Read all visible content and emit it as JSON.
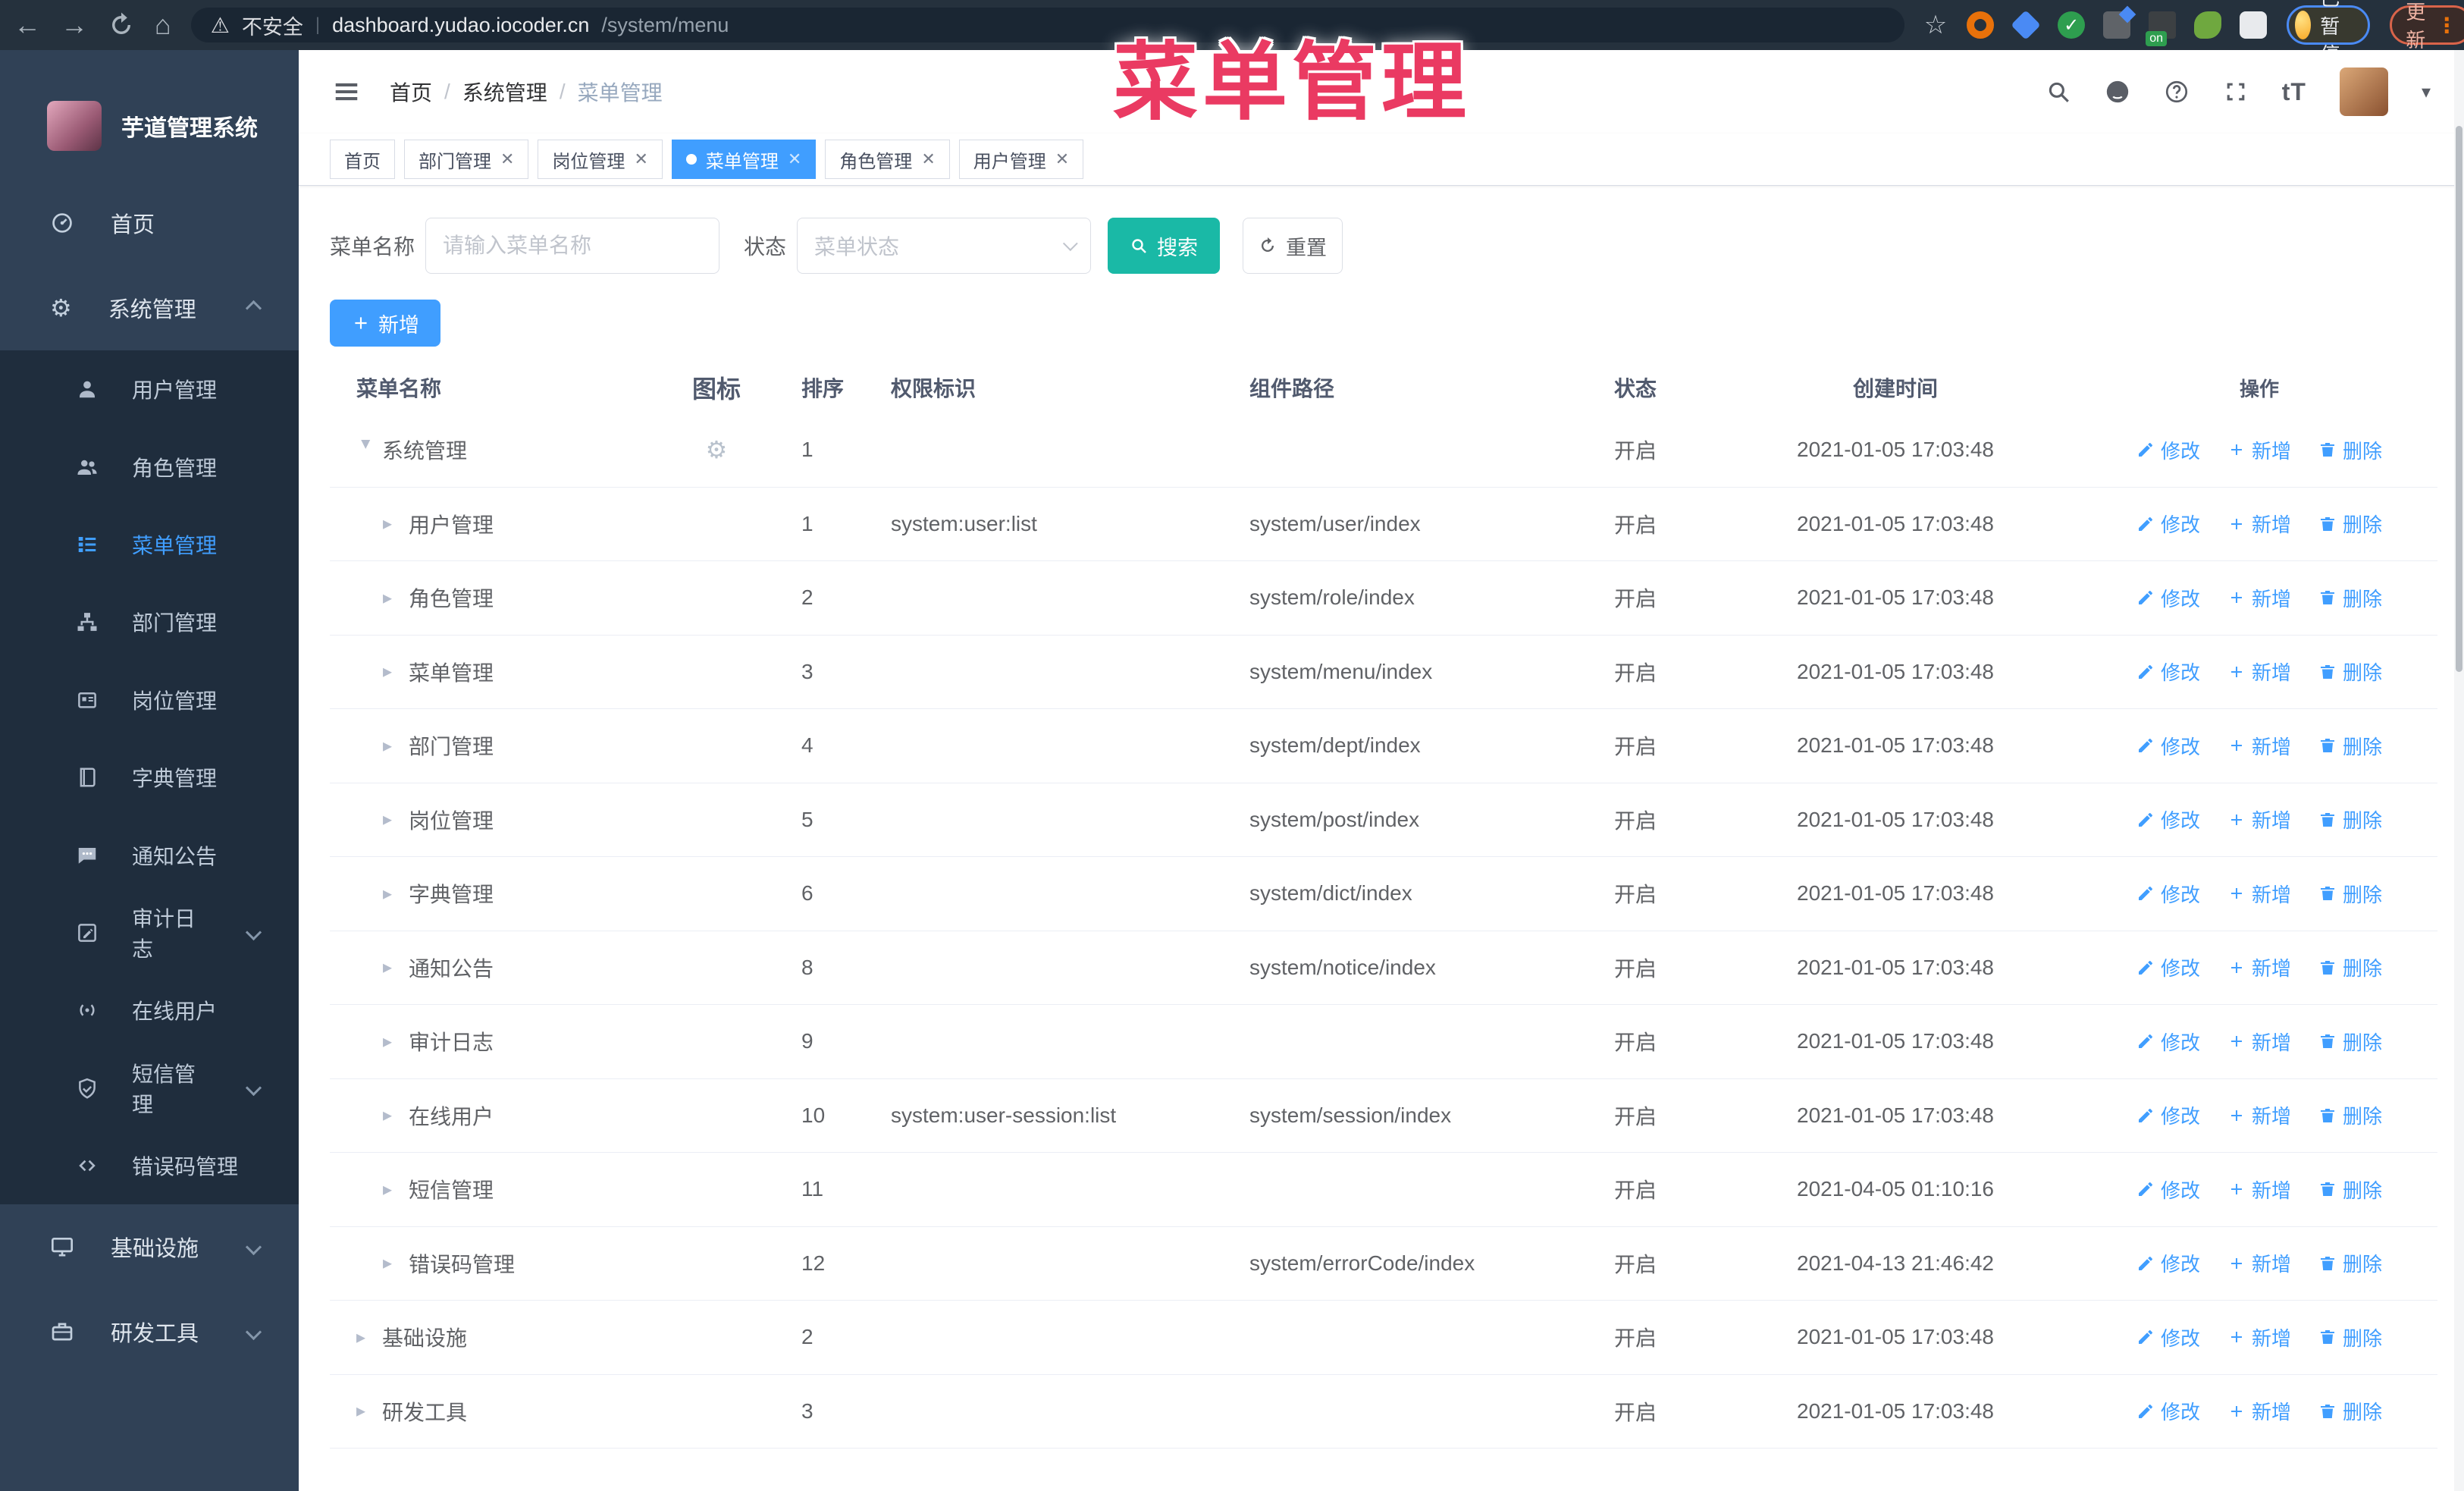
{
  "browser": {
    "security_label": "不安全",
    "url_host": "dashboard.yudao.iocoder.cn",
    "url_path": "/system/menu",
    "paused_badge": "已暂停",
    "update_button": "更新"
  },
  "annotation": {
    "text": "菜单管理",
    "color": "#ea3a62"
  },
  "sidebar": {
    "title": "芋道管理系统",
    "items": [
      {
        "label": "首页",
        "icon": "dashboard",
        "type": "top"
      },
      {
        "label": "系统管理",
        "icon": "cog",
        "type": "top",
        "caret": "up"
      },
      {
        "label": "用户管理",
        "icon": "user",
        "type": "sub"
      },
      {
        "label": "角色管理",
        "icon": "users",
        "type": "sub"
      },
      {
        "label": "菜单管理",
        "icon": "tree-table",
        "type": "sub",
        "active": true
      },
      {
        "label": "部门管理",
        "icon": "tree",
        "type": "sub"
      },
      {
        "label": "岗位管理",
        "icon": "post",
        "type": "sub"
      },
      {
        "label": "字典管理",
        "icon": "dict",
        "type": "sub"
      },
      {
        "label": "通知公告",
        "icon": "message",
        "type": "sub"
      },
      {
        "label": "审计日志",
        "icon": "log",
        "type": "sub",
        "caret": "down"
      },
      {
        "label": "在线用户",
        "icon": "online",
        "type": "sub"
      },
      {
        "label": "短信管理",
        "icon": "sms",
        "type": "sub",
        "caret": "down"
      },
      {
        "label": "错误码管理",
        "icon": "code",
        "type": "sub"
      },
      {
        "label": "基础设施",
        "icon": "monitor",
        "type": "top",
        "caret": "down"
      },
      {
        "label": "研发工具",
        "icon": "tool",
        "type": "top",
        "caret": "down"
      }
    ]
  },
  "header": {
    "breadcrumb": [
      "首页",
      "系统管理",
      "菜单管理"
    ]
  },
  "tags": [
    {
      "label": "首页",
      "closable": false,
      "active": false
    },
    {
      "label": "部门管理",
      "closable": true,
      "active": false
    },
    {
      "label": "岗位管理",
      "closable": true,
      "active": false
    },
    {
      "label": "菜单管理",
      "closable": true,
      "active": true
    },
    {
      "label": "角色管理",
      "closable": true,
      "active": false
    },
    {
      "label": "用户管理",
      "closable": true,
      "active": false
    }
  ],
  "search": {
    "name_label": "菜单名称",
    "name_placeholder": "请输入菜单名称",
    "status_label": "状态",
    "status_placeholder": "菜单状态",
    "search_button": "搜索",
    "reset_button": "重置"
  },
  "toolbar": {
    "add_button": "新增"
  },
  "table": {
    "columns": [
      "菜单名称",
      "图标",
      "排序",
      "权限标识",
      "组件路径",
      "状态",
      "创建时间",
      "操作"
    ],
    "ops": {
      "edit": "修改",
      "add": "新增",
      "delete": "删除"
    },
    "rows": [
      {
        "name": "系统管理",
        "icon": "cog",
        "level": 0,
        "expanded": true,
        "sort": "1",
        "perm": "",
        "path": "",
        "status": "开启",
        "time": "2021-01-05 17:03:48"
      },
      {
        "name": "用户管理",
        "icon": "user",
        "level": 1,
        "expanded": false,
        "sort": "1",
        "perm": "system:user:list",
        "path": "system/user/index",
        "status": "开启",
        "time": "2021-01-05 17:03:48"
      },
      {
        "name": "角色管理",
        "icon": "users",
        "level": 1,
        "expanded": false,
        "sort": "2",
        "perm": "",
        "path": "system/role/index",
        "status": "开启",
        "time": "2021-01-05 17:03:48"
      },
      {
        "name": "菜单管理",
        "icon": "tree-table",
        "level": 1,
        "expanded": false,
        "sort": "3",
        "perm": "",
        "path": "system/menu/index",
        "status": "开启",
        "time": "2021-01-05 17:03:48"
      },
      {
        "name": "部门管理",
        "icon": "tree",
        "level": 1,
        "expanded": false,
        "sort": "4",
        "perm": "",
        "path": "system/dept/index",
        "status": "开启",
        "time": "2021-01-05 17:03:48"
      },
      {
        "name": "岗位管理",
        "icon": "post",
        "level": 1,
        "expanded": false,
        "sort": "5",
        "perm": "",
        "path": "system/post/index",
        "status": "开启",
        "time": "2021-01-05 17:03:48"
      },
      {
        "name": "字典管理",
        "icon": "dict",
        "level": 1,
        "expanded": false,
        "sort": "6",
        "perm": "",
        "path": "system/dict/index",
        "status": "开启",
        "time": "2021-01-05 17:03:48"
      },
      {
        "name": "通知公告",
        "icon": "message",
        "level": 1,
        "expanded": false,
        "sort": "8",
        "perm": "",
        "path": "system/notice/index",
        "status": "开启",
        "time": "2021-01-05 17:03:48"
      },
      {
        "name": "审计日志",
        "icon": "log",
        "level": 1,
        "expanded": false,
        "sort": "9",
        "perm": "",
        "path": "",
        "status": "开启",
        "time": "2021-01-05 17:03:48"
      },
      {
        "name": "在线用户",
        "icon": "online",
        "level": 1,
        "expanded": false,
        "sort": "10",
        "perm": "system:user-session:list",
        "path": "system/session/index",
        "status": "开启",
        "time": "2021-01-05 17:03:48"
      },
      {
        "name": "短信管理",
        "icon": "sms",
        "level": 1,
        "expanded": false,
        "sort": "11",
        "perm": "",
        "path": "",
        "status": "开启",
        "time": "2021-04-05 01:10:16"
      },
      {
        "name": "错误码管理",
        "icon": "code",
        "level": 1,
        "expanded": false,
        "sort": "12",
        "perm": "",
        "path": "system/errorCode/index",
        "status": "开启",
        "time": "2021-04-13 21:46:42"
      },
      {
        "name": "基础设施",
        "icon": "monitor",
        "level": 0,
        "expanded": false,
        "sort": "2",
        "perm": "",
        "path": "",
        "status": "开启",
        "time": "2021-01-05 17:03:48"
      },
      {
        "name": "研发工具",
        "icon": "tool",
        "level": 0,
        "expanded": false,
        "sort": "3",
        "perm": "",
        "path": "",
        "status": "开启",
        "time": "2021-01-05 17:03:48"
      }
    ]
  },
  "colors": {
    "accent": "#409eff",
    "teal": "#1ab9a6",
    "pink": "#ea3a62",
    "sidebar_bg": "#304156",
    "submenu_bg": "#1f2d3d"
  }
}
